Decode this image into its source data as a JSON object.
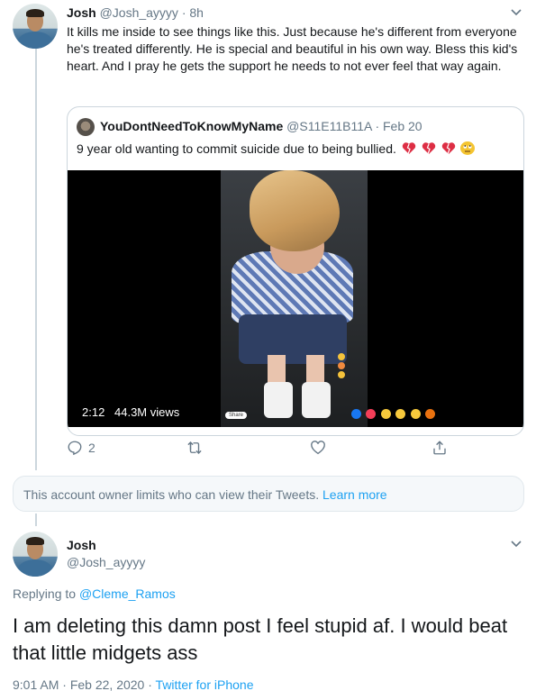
{
  "tweet1": {
    "name": "Josh",
    "handle": "@Josh_ayyyy",
    "sep": "·",
    "time": "8h",
    "text": "It kills me inside to see things like this. Just because he's different from everyone he's treated differently. He is special and beautiful in his own way. Bless this kid's heart. And I pray he gets the support he needs to not ever feel that way again.",
    "quote": {
      "name": "YouDontNeedToKnowMyName",
      "handle": "@S11E11B11A",
      "sep": "·",
      "date": "Feb 20",
      "text": "9 year old wanting to commit suicide due to being bullied.",
      "emojis": [
        "broken-heart-icon",
        "broken-heart-icon",
        "broken-heart-icon",
        "eye-roll-emoji-icon"
      ],
      "video": {
        "duration": "2:12",
        "views": "44.3M views",
        "share_label": "Share"
      }
    },
    "actions": {
      "reply_count": "2",
      "retweet_count": "",
      "like_count": ""
    }
  },
  "limits_notice": {
    "text": "This account owner limits who can view their Tweets.",
    "link": "Learn more"
  },
  "tweet2": {
    "name": "Josh",
    "handle": "@Josh_ayyyy",
    "replying_prefix": "Replying to",
    "replying_to": "@Cleme_Ramos",
    "text": "I am deleting this damn post I feel stupid af. I would beat that little midgets ass",
    "time": "9:01 AM",
    "sep1": "·",
    "date": "Feb 22, 2020",
    "sep2": "·",
    "source": "Twitter for iPhone"
  },
  "colors": {
    "accent": "#1da1f2",
    "muted": "#657786",
    "text": "#14171a",
    "border": "#ccd6dd"
  }
}
